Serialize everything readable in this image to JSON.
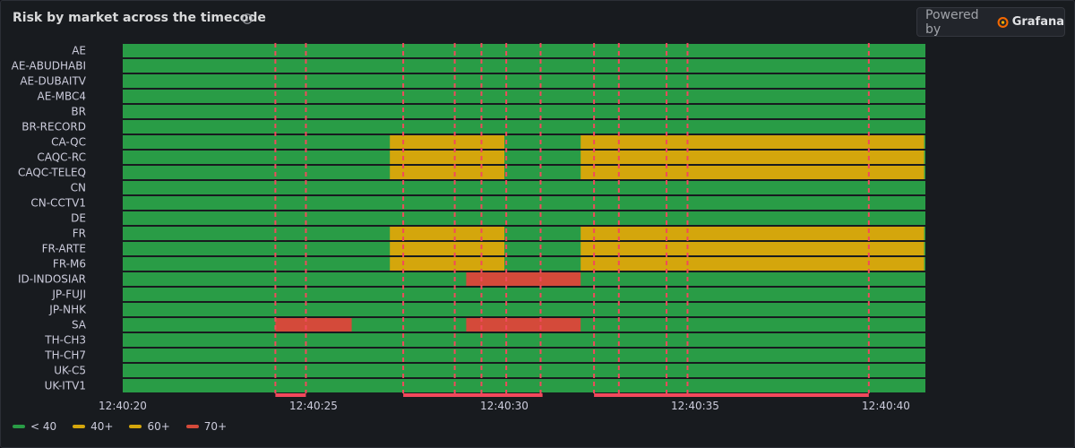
{
  "panel": {
    "title": "Risk by market across the timecode",
    "info_icon": "info-circle-icon",
    "powered_by": "Powered by",
    "brand": "Grafana",
    "brand_icon": "grafana-logo-icon"
  },
  "colors": {
    "low": "#299c46",
    "medium": "#d4a60c",
    "high": "#d44a3a",
    "marker": "#f2495c"
  },
  "chart_data": {
    "type": "state-timeline",
    "title": "Risk by market across the timecode",
    "x_ticks": [
      "12:40:20",
      "12:40:25",
      "12:40:30",
      "12:40:35",
      "12:40:40"
    ],
    "x_tick_values": [
      0,
      5,
      10,
      15,
      20
    ],
    "x_range": [
      0,
      21
    ],
    "legend": [
      {
        "label": "< 40",
        "level": "low"
      },
      {
        "label": "40+",
        "level": "40+"
      },
      {
        "label": "60+",
        "level": "medium"
      },
      {
        "label": "70+",
        "level": "high"
      }
    ],
    "markets": [
      "AE",
      "AE-ABUDHABI",
      "AE-DUBAITV",
      "AE-MBC4",
      "BR",
      "BR-RECORD",
      "CA-QC",
      "CAQC-RC",
      "CAQC-TELEQ",
      "CN",
      "CN-CCTV1",
      "DE",
      "FR",
      "FR-ARTE",
      "FR-M6",
      "ID-INDOSIAR",
      "JP-FUJI",
      "JP-NHK",
      "SA",
      "TH-CH3",
      "TH-CH7",
      "UK-C5",
      "UK-ITV1"
    ],
    "segments": [
      {
        "market": "CA-QC",
        "start": 7.0,
        "end": 10.0,
        "level": "medium"
      },
      {
        "market": "CA-QC",
        "start": 12.0,
        "end": 21.0,
        "level": "medium"
      },
      {
        "market": "CAQC-RC",
        "start": 7.0,
        "end": 10.0,
        "level": "medium"
      },
      {
        "market": "CAQC-RC",
        "start": 12.0,
        "end": 21.0,
        "level": "medium"
      },
      {
        "market": "CAQC-TELEQ",
        "start": 7.0,
        "end": 10.0,
        "level": "medium"
      },
      {
        "market": "CAQC-TELEQ",
        "start": 12.0,
        "end": 21.0,
        "level": "medium"
      },
      {
        "market": "FR",
        "start": 7.0,
        "end": 10.0,
        "level": "medium"
      },
      {
        "market": "FR",
        "start": 12.0,
        "end": 21.0,
        "level": "medium"
      },
      {
        "market": "FR-ARTE",
        "start": 7.0,
        "end": 10.0,
        "level": "medium"
      },
      {
        "market": "FR-ARTE",
        "start": 12.0,
        "end": 21.0,
        "level": "medium"
      },
      {
        "market": "FR-M6",
        "start": 7.0,
        "end": 10.0,
        "level": "medium"
      },
      {
        "market": "FR-M6",
        "start": 12.0,
        "end": 21.0,
        "level": "medium"
      },
      {
        "market": "ID-INDOSIAR",
        "start": 9.0,
        "end": 12.0,
        "level": "high"
      },
      {
        "market": "SA",
        "start": 4.0,
        "end": 6.0,
        "level": "high"
      },
      {
        "market": "SA",
        "start": 9.0,
        "end": 12.0,
        "level": "high"
      }
    ],
    "annotations": [
      4.0,
      4.8,
      7.35,
      8.7,
      9.4,
      10.05,
      10.95,
      12.35,
      13.0,
      14.25,
      14.8,
      19.55
    ],
    "annotation_regions": [
      {
        "start": 4.0,
        "end": 4.8
      },
      {
        "start": 7.35,
        "end": 11.0
      },
      {
        "start": 12.35,
        "end": 19.55
      }
    ]
  }
}
